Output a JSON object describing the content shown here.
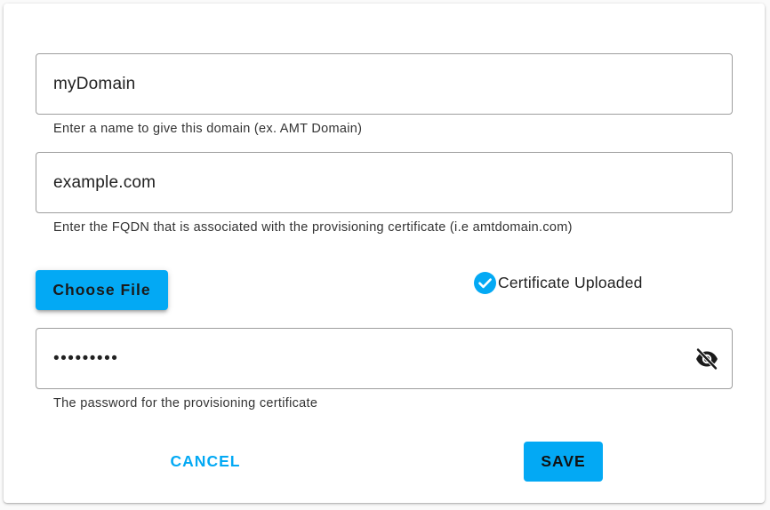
{
  "form": {
    "name": {
      "value": "myDomain",
      "hint": "Enter a name to give this domain (ex. AMT Domain)"
    },
    "fqdn": {
      "value": "example.com",
      "hint": "Enter the FQDN that is associated with the provisioning certificate (i.e amtdomain.com)"
    },
    "certificate": {
      "choose_file_label": "Choose File",
      "status_icon": "check-circle-icon",
      "status_label": "Certificate Uploaded"
    },
    "password": {
      "masked_value": "•••••••••",
      "visibility_icon": "eye-off-icon",
      "hint": "The password for the provisioning certificate"
    }
  },
  "actions": {
    "cancel_label": "CANCEL",
    "save_label": "SAVE"
  },
  "colors": {
    "accent": "#03a9f4",
    "border": "#9e9e9e",
    "text": "#212121"
  }
}
